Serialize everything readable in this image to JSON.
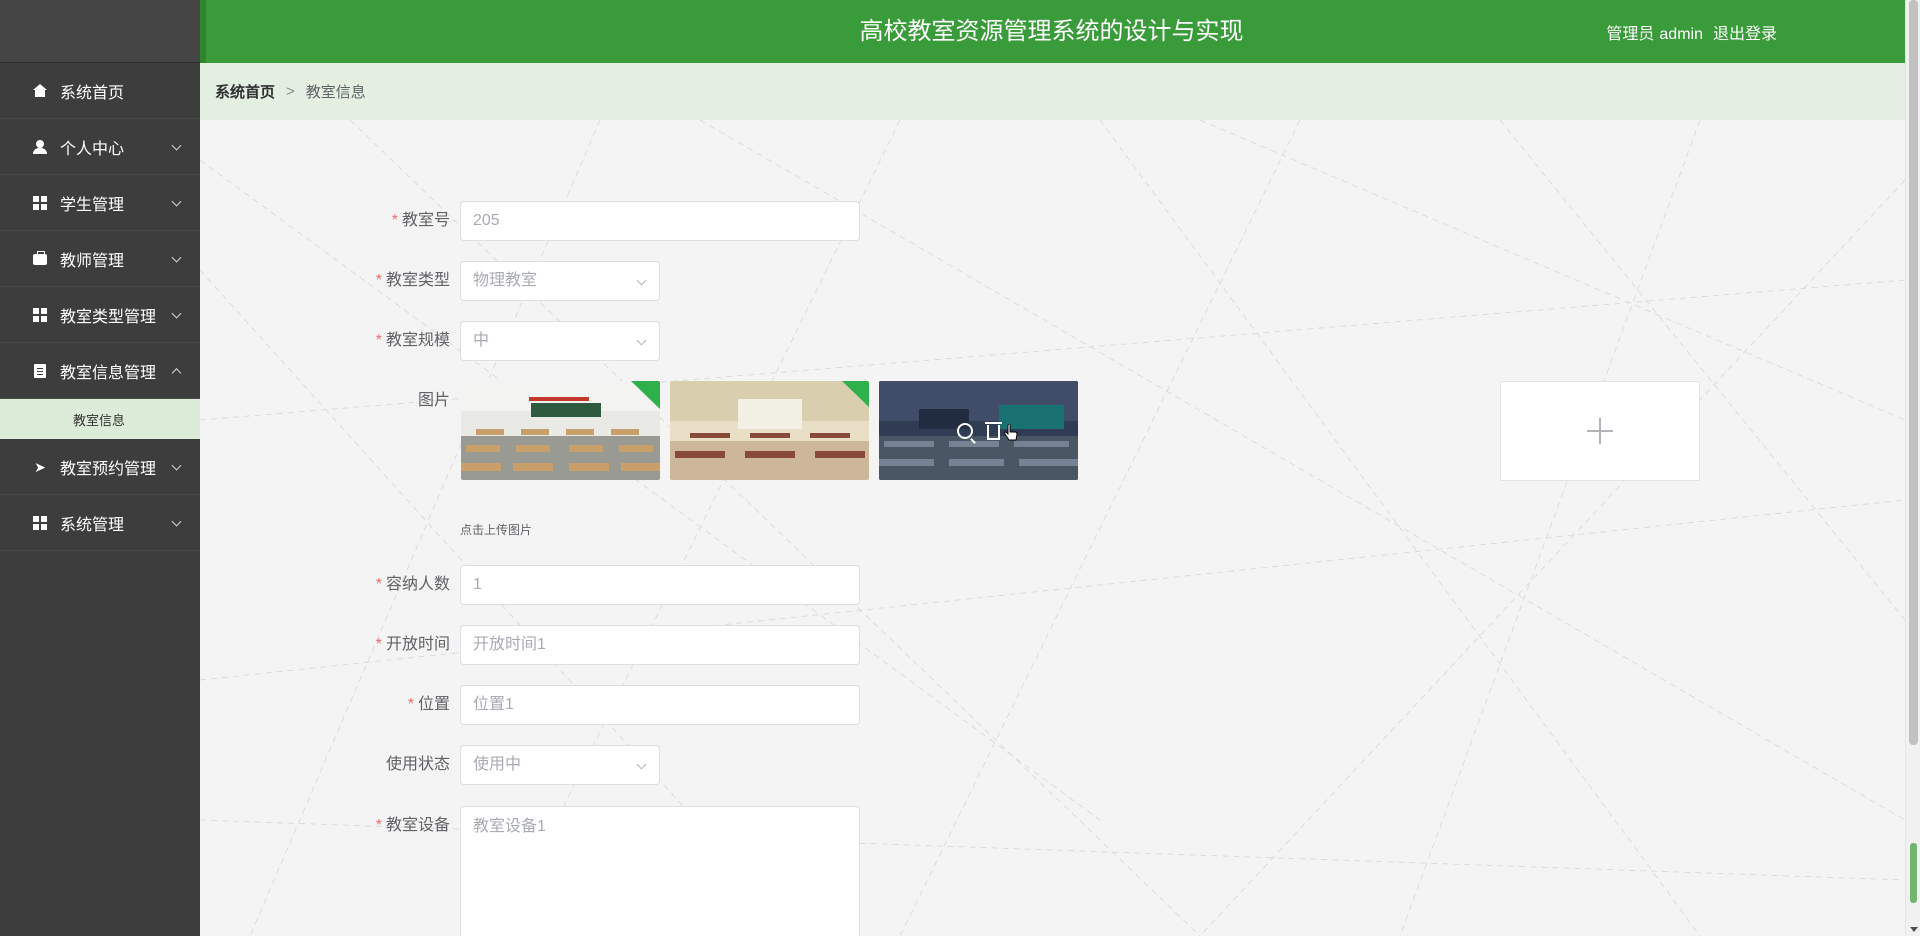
{
  "header": {
    "title": "高校教室资源管理系统的设计与实现",
    "user_role": "管理员",
    "user_name": "admin",
    "logout_label": "退出登录",
    "accent_color": "#3a9b3a"
  },
  "sidebar": {
    "items": [
      {
        "label": "系统首页",
        "icon": "home-icon",
        "expandable": false
      },
      {
        "label": "个人中心",
        "icon": "user-icon",
        "expandable": true
      },
      {
        "label": "学生管理",
        "icon": "grid-icon",
        "expandable": true
      },
      {
        "label": "教师管理",
        "icon": "briefcase-icon",
        "expandable": true
      },
      {
        "label": "教室类型管理",
        "icon": "grid-icon",
        "expandable": true
      },
      {
        "label": "教室信息管理",
        "icon": "clipboard-icon",
        "expandable": true,
        "expanded": true,
        "subitems": [
          "教室信息"
        ]
      },
      {
        "label": "教室预约管理",
        "icon": "paper-plane-icon",
        "expandable": true
      },
      {
        "label": "系统管理",
        "icon": "grid-icon",
        "expandable": true
      }
    ]
  },
  "breadcrumb": {
    "home": "系统首页",
    "separator": ">",
    "current": "教室信息"
  },
  "form": {
    "classroom_no": {
      "label": "教室号",
      "required": true,
      "value": "205"
    },
    "classroom_type": {
      "label": "教室类型",
      "required": true,
      "value": "物理教室"
    },
    "classroom_scale": {
      "label": "教室规模",
      "required": true,
      "value": "中"
    },
    "images": {
      "label": "图片",
      "required": false,
      "upload_tip": "点击上传图片",
      "count": 3
    },
    "capacity": {
      "label": "容纳人数",
      "required": true,
      "value": "1"
    },
    "open_time": {
      "label": "开放时间",
      "required": true,
      "value": "开放时间1"
    },
    "location": {
      "label": "位置",
      "required": true,
      "value": "位置1"
    },
    "status": {
      "label": "使用状态",
      "required": false,
      "value": "使用中"
    },
    "equipment": {
      "label": "教室设备",
      "required": true,
      "value": "教室设备1"
    }
  }
}
